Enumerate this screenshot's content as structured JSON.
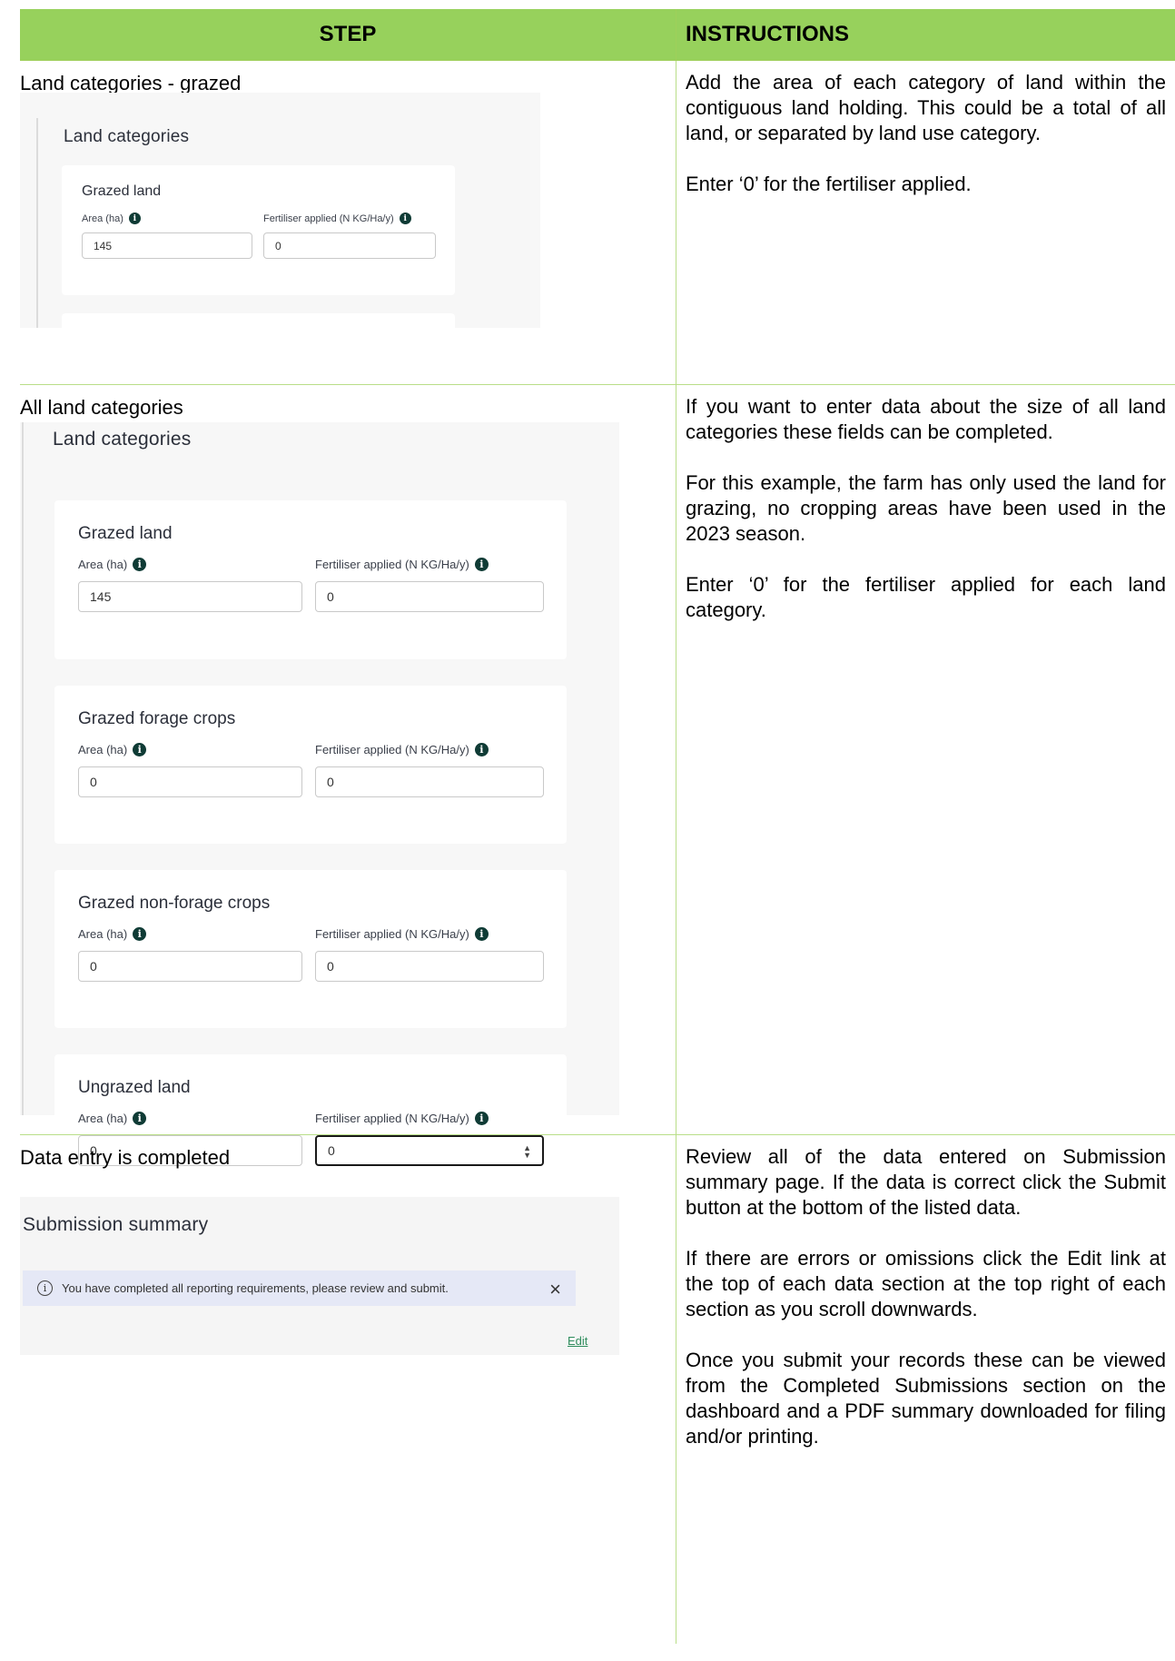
{
  "table": {
    "col_step": "STEP",
    "col_instructions": "INSTRUCTIONS"
  },
  "rows": [
    {
      "step": "Land categories - grazed",
      "paragraphs": [
        "Add the area of each category of land within the contiguous land holding. This could be a total of all land, or separated by land use category.",
        "Enter ‘0’ for the fertiliser applied."
      ]
    },
    {
      "step": "All land categories",
      "paragraphs": [
        "If you want to enter data about the size of all land categories these fields can be completed.",
        "For this example, the farm has only used the land for grazing, no cropping areas have been used in the 2023 season.",
        "Enter ‘0’ for the fertiliser applied for each land category."
      ]
    },
    {
      "step": "Data entry is completed",
      "paragraphs": [
        "Review all of the data entered on Submission summary page. If the data is correct click the Submit button at the bottom of the listed data.",
        "If there are errors or omissions click the Edit link at the top of each data section at the top right of each section as you scroll downwards.",
        "Once you submit your records these can be viewed from the Completed Submissions section on the dashboard and a PDF summary downloaded for filing and/or printing."
      ]
    }
  ],
  "form": {
    "section_title": "Land categories",
    "area_label": "Area (ha)",
    "fert_label": "Fertiliser applied (N KG/Ha/y)",
    "cards": [
      {
        "title": "Grazed land",
        "area": "145",
        "fert": "0"
      },
      {
        "title": "Grazed forage crops",
        "area": "0",
        "fert": "0"
      },
      {
        "title": "Grazed non-forage crops",
        "area": "0",
        "fert": "0"
      },
      {
        "title": "Ungrazed land",
        "area": "0",
        "fert": "0"
      }
    ]
  },
  "summary": {
    "title": "Submission summary",
    "alert": "You have completed all reporting requirements, please review and submit.",
    "edit": "Edit"
  }
}
